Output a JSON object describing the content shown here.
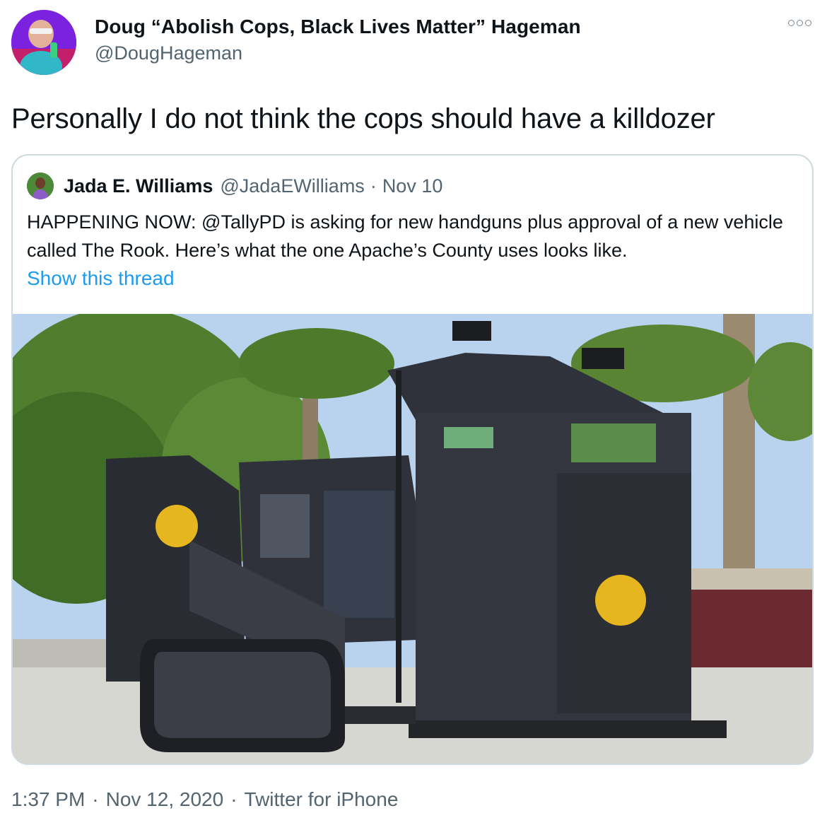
{
  "author": {
    "display_name": "Doug “Abolish Cops, Black Lives Matter” Hageman",
    "handle": "@DougHageman",
    "avatar_icon": "profile-photo"
  },
  "tweet": {
    "text": "Personally I do not think the cops should have a killdozer"
  },
  "quoted_tweet": {
    "display_name": "Jada E. Williams",
    "handle": "@JadaEWilliams",
    "separator": "·",
    "date": "Nov 10",
    "text": "HAPPENING NOW: @TallyPD is asking for new handguns plus approval of a new vehicle called The Rook. Here’s what the one Apache’s County uses looks like.",
    "show_thread": "Show this thread",
    "photo_description_icon": "armored-vehicle-photo"
  },
  "footer": {
    "time": "1:37 PM",
    "separator": "·",
    "date": "Nov 12, 2020",
    "source": "Twitter for iPhone"
  },
  "colors": {
    "link": "#1d9bf0",
    "secondary_text": "#536471",
    "border": "#cfd9de"
  }
}
